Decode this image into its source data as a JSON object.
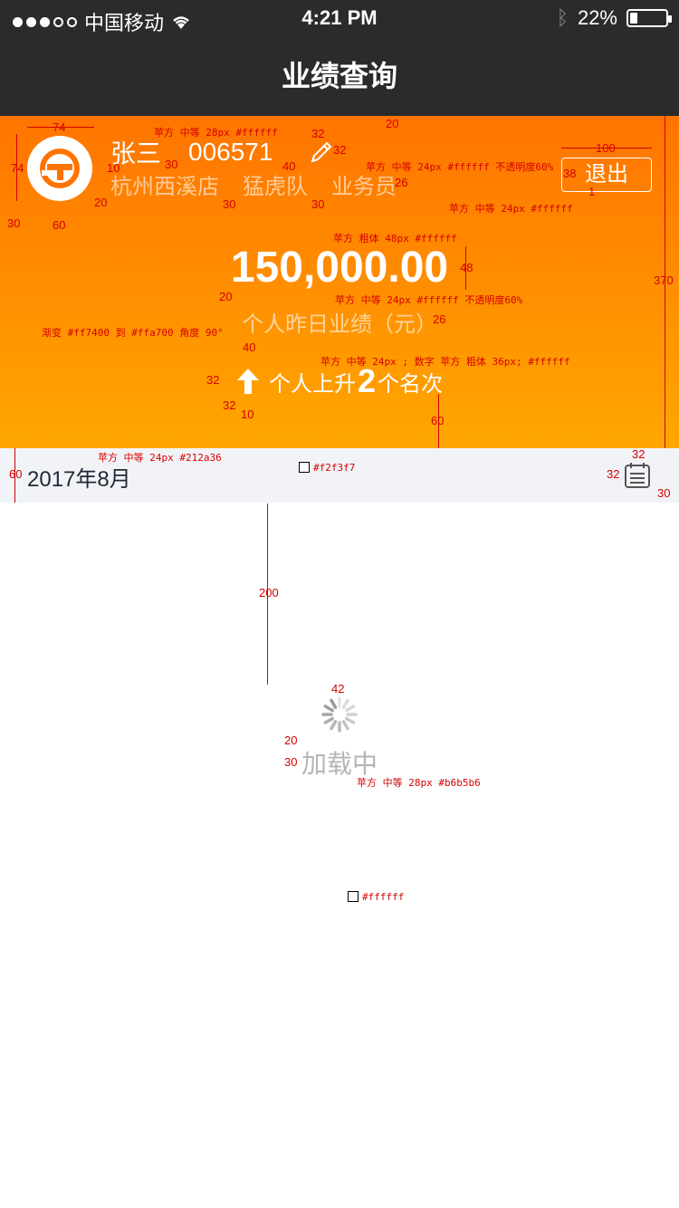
{
  "status_bar": {
    "carrier": "中国移动",
    "time": "4:21 PM",
    "battery": "22%"
  },
  "nav": {
    "title": "业绩查询"
  },
  "profile": {
    "name": "张三",
    "id": "006571",
    "store": "杭州西溪店",
    "team": "猛虎队",
    "role": "业务员",
    "logout": "退出"
  },
  "performance": {
    "amount": "150,000.00",
    "label": "个人昨日业绩（元）",
    "rank_prefix": "个人上升",
    "rank_value": "2",
    "rank_suffix": "个名次"
  },
  "date_bar": {
    "date": "2017年8月"
  },
  "loading": {
    "text": "加载中"
  },
  "annotations": {
    "name_font": "苹方 中等 28px #ffffff",
    "info_font": "苹方 中等 24px #ffffff 不透明度60%",
    "logout_font": "苹方 中等 24px #ffffff",
    "amount_font": "苹方 粗体 48px #ffffff",
    "label_font": "苹方 中等 24px #ffffff 不透明度60%",
    "gradient": "渐变 #ff7400 到 #ffa700 角度 90°",
    "rank_font": "苹方 中等 24px ; 数字 苹方 粗体 36px; #ffffff",
    "date_font": "苹方 中等 24px #212a36",
    "date_bg": "#f2f3f7",
    "loading_font": "苹方 中等 28px #b6b5b6",
    "page_bg": "#ffffff",
    "dims": [
      "74",
      "74",
      "10",
      "30",
      "20",
      "30",
      "40",
      "32",
      "32",
      "20",
      "100",
      "38",
      "1",
      "26",
      "30",
      "60",
      "30",
      "48",
      "20",
      "26",
      "40",
      "32",
      "32",
      "10",
      "60",
      "370",
      "60",
      "32",
      "32",
      "30",
      "200",
      "42",
      "20",
      "30"
    ]
  },
  "colors": {
    "gradient_start": "#ff7400",
    "gradient_end": "#ffa700",
    "date_bg": "#f2f3f7",
    "date_text": "#212a36",
    "loading_text": "#b6b5b6",
    "nav_bg": "#2b2b2b"
  }
}
